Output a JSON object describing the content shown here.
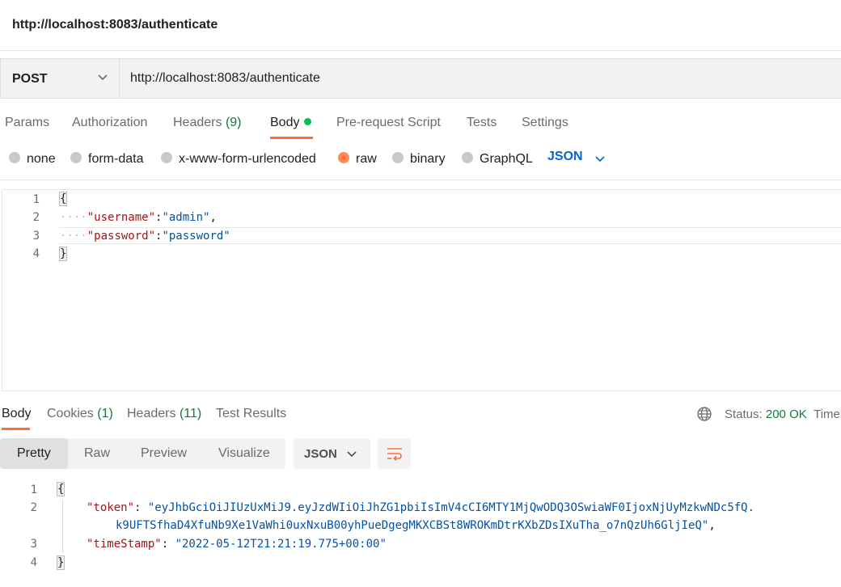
{
  "title": "http://localhost:8083/authenticate",
  "request": {
    "method": "POST",
    "url": "http://localhost:8083/authenticate"
  },
  "request_tabs": {
    "params": "Params",
    "authorization": "Authorization",
    "headers_label": "Headers",
    "headers_count": "(9)",
    "body": "Body",
    "prerequest": "Pre-request Script",
    "tests": "Tests",
    "settings": "Settings"
  },
  "body_types": {
    "none": "none",
    "form_data": "form-data",
    "urlencoded": "x-www-form-urlencoded",
    "raw": "raw",
    "binary": "binary",
    "graphql": "GraphQL",
    "selected": "raw",
    "language": "JSON"
  },
  "request_body": {
    "line_numbers": [
      "1",
      "2",
      "3",
      "4"
    ],
    "open_brace": "{",
    "indent_dots": "····",
    "username_key": "\"username\"",
    "username_value": "\"admin\"",
    "password_key": "\"password\"",
    "password_value": "\"password\"",
    "close_brace": "}"
  },
  "response_tabs": {
    "body": "Body",
    "cookies_label": "Cookies",
    "cookies_count": "(1)",
    "headers_label": "Headers",
    "headers_count": "(11)",
    "test_results": "Test Results"
  },
  "response_status": {
    "label": "Status:",
    "value": "200 OK",
    "time_label": "Time"
  },
  "view_modes": {
    "pretty": "Pretty",
    "raw": "Raw",
    "preview": "Preview",
    "visualize": "Visualize",
    "format": "JSON"
  },
  "response_body": {
    "line_numbers": [
      "1",
      "2",
      "3",
      "4"
    ],
    "open_brace": "{",
    "token_key": "\"token\"",
    "token_value_line1": "\"eyJhbGciOiJIUzUxMiJ9.eyJzdWIiOiJhZG1pbiIsImV4cCI6MTY1MjQwODQ3OSwiaWF0IjoxNjUyMzkwNDc5fQ.",
    "token_value_line2": "k9UFTSfhaD4XfuNb9Xe1VaWhi0uxNxuB00yhPueDgegMKXCBSt8WROKmDtrKXbZDsIXuTha_o7nQzUh6GljIeQ\"",
    "timestamp_key": "\"timeStamp\"",
    "timestamp_value": "\"2022-05-12T21:21:19.775+00:00\"",
    "close_brace": "}"
  },
  "colors": {
    "accent": "#ff6c37",
    "status_ok": "#0f7c3a",
    "json_blue": "#0265d2",
    "key_red": "#a31515",
    "string_blue": "#0451a5"
  }
}
